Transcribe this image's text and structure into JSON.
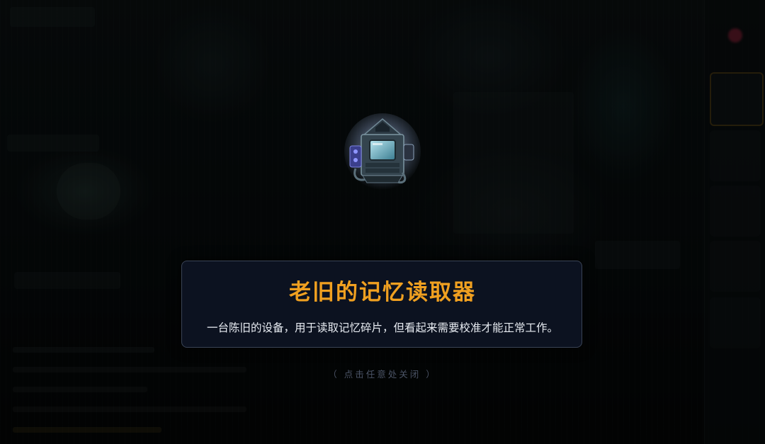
{
  "item": {
    "title": "老旧的记忆读取器",
    "description": "一台陈旧的设备，用于读取记忆碎片，但看起来需要校准才能正常工作。",
    "icon": "old-computer-icon"
  },
  "close_hint": "（ 点击任意处关闭 ）",
  "colors": {
    "title": "#f0a020",
    "dialog_bg": "#0c1220",
    "dialog_border": "#3a4456",
    "description": "#e8ecf2",
    "hint": "#4b5466"
  }
}
